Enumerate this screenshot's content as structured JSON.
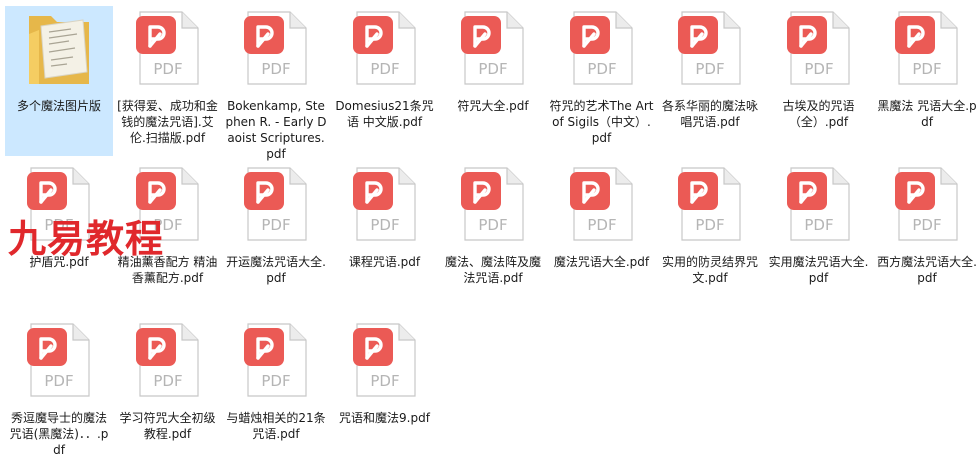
{
  "watermark": "九易教程",
  "pdf_badge": "PDF",
  "items": [
    {
      "type": "folder",
      "name": "多个魔法图片版",
      "selected": true
    },
    {
      "type": "pdf",
      "name": "[获得爱、成功和金钱的魔法咒语].艾伦.扫描版.pdf"
    },
    {
      "type": "pdf",
      "name": "Bokenkamp, Stephen R. - Early Daoist Scriptures.pdf"
    },
    {
      "type": "pdf",
      "name": "Domesius21条咒语 中文版.pdf"
    },
    {
      "type": "pdf",
      "name": "符咒大全.pdf"
    },
    {
      "type": "pdf",
      "name": "符咒的艺术The Art of Sigils（中文）.pdf"
    },
    {
      "type": "pdf",
      "name": "各系华丽的魔法咏唱咒语.pdf"
    },
    {
      "type": "pdf",
      "name": "古埃及的咒语（全）.pdf"
    },
    {
      "type": "pdf",
      "name": "黑魔法 咒语大全.pdf"
    },
    {
      "type": "pdf",
      "name": "护盾咒.pdf"
    },
    {
      "type": "pdf",
      "name": "精油薰香配方 精油香薰配方.pdf"
    },
    {
      "type": "pdf",
      "name": "开运魔法咒语大全.pdf"
    },
    {
      "type": "pdf",
      "name": "课程咒语.pdf"
    },
    {
      "type": "pdf",
      "name": "魔法、魔法阵及魔法咒语.pdf"
    },
    {
      "type": "pdf",
      "name": "魔法咒语大全.pdf"
    },
    {
      "type": "pdf",
      "name": "实用的防灵结界咒文.pdf"
    },
    {
      "type": "pdf",
      "name": "实用魔法咒语大全.pdf"
    },
    {
      "type": "pdf",
      "name": "西方魔法咒语大全.pdf"
    },
    {
      "type": "pdf",
      "name": "秀逗魔导士的魔法咒语(黑魔法)．．.pdf"
    },
    {
      "type": "pdf",
      "name": "学习符咒大全初级教程.pdf"
    },
    {
      "type": "pdf",
      "name": "与蜡烛相关的21条咒语.pdf"
    },
    {
      "type": "pdf",
      "name": "咒语和魔法9.pdf"
    }
  ]
}
